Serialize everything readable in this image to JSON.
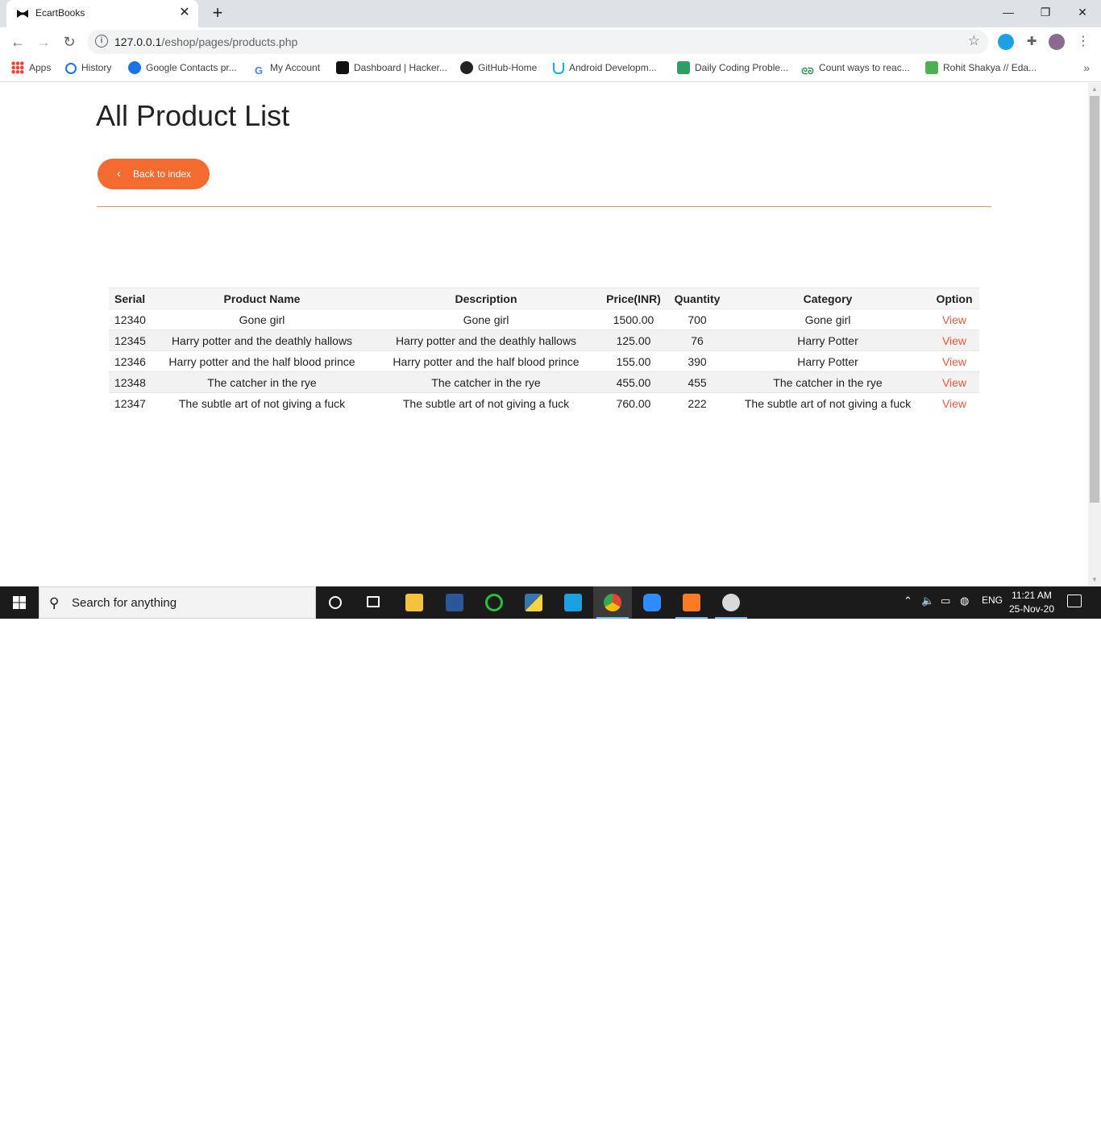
{
  "browser": {
    "tab_title": "EcartBooks",
    "url_host": "127.0.0.1",
    "url_path": "/eshop/pages/products.php",
    "bookmarks": [
      {
        "label": "Apps"
      },
      {
        "label": "History"
      },
      {
        "label": "Google Contacts pr..."
      },
      {
        "label": "My Account"
      },
      {
        "label": "Dashboard | Hacker..."
      },
      {
        "label": "GitHub-Home"
      },
      {
        "label": "Android Developm..."
      },
      {
        "label": "Daily Coding Proble..."
      },
      {
        "label": "Count ways to reac..."
      },
      {
        "label": "Rohit Shakya // Eda..."
      }
    ],
    "bookmarks_overflow": "»"
  },
  "page": {
    "title": "All Product List",
    "back_button_label": "Back to index",
    "accent_color": "#f36b2e",
    "link_color": "#e8593a",
    "table": {
      "headers": [
        "Serial",
        "Product Name",
        "Description",
        "Price(INR)",
        "Quantity",
        "Category",
        "Option"
      ],
      "rows": [
        {
          "serial": "12340",
          "name": "Gone girl",
          "description": "Gone girl",
          "price": "1500.00",
          "quantity": "700",
          "category": "Gone girl",
          "option": "View"
        },
        {
          "serial": "12345",
          "name": "Harry potter and the deathly hallows",
          "description": "Harry potter and the deathly hallows",
          "price": "125.00",
          "quantity": "76",
          "category": "Harry Potter",
          "option": "View"
        },
        {
          "serial": "12346",
          "name": "Harry potter and the half blood prince",
          "description": "Harry potter and the half blood prince",
          "price": "155.00",
          "quantity": "390",
          "category": "Harry Potter",
          "option": "View"
        },
        {
          "serial": "12348",
          "name": "The catcher in the rye",
          "description": "The catcher in the rye",
          "price": "455.00",
          "quantity": "455",
          "category": "The catcher in the rye",
          "option": "View"
        },
        {
          "serial": "12347",
          "name": "The subtle art of not giving a fuck",
          "description": "The subtle art of not giving a fuck",
          "price": "760.00",
          "quantity": "222",
          "category": "The subtle art of not giving a fuck",
          "option": "View"
        }
      ]
    }
  },
  "taskbar": {
    "search_placeholder": "Search for anything",
    "language": "ENG",
    "time": "11:21 AM",
    "date": "25-Nov-20"
  }
}
